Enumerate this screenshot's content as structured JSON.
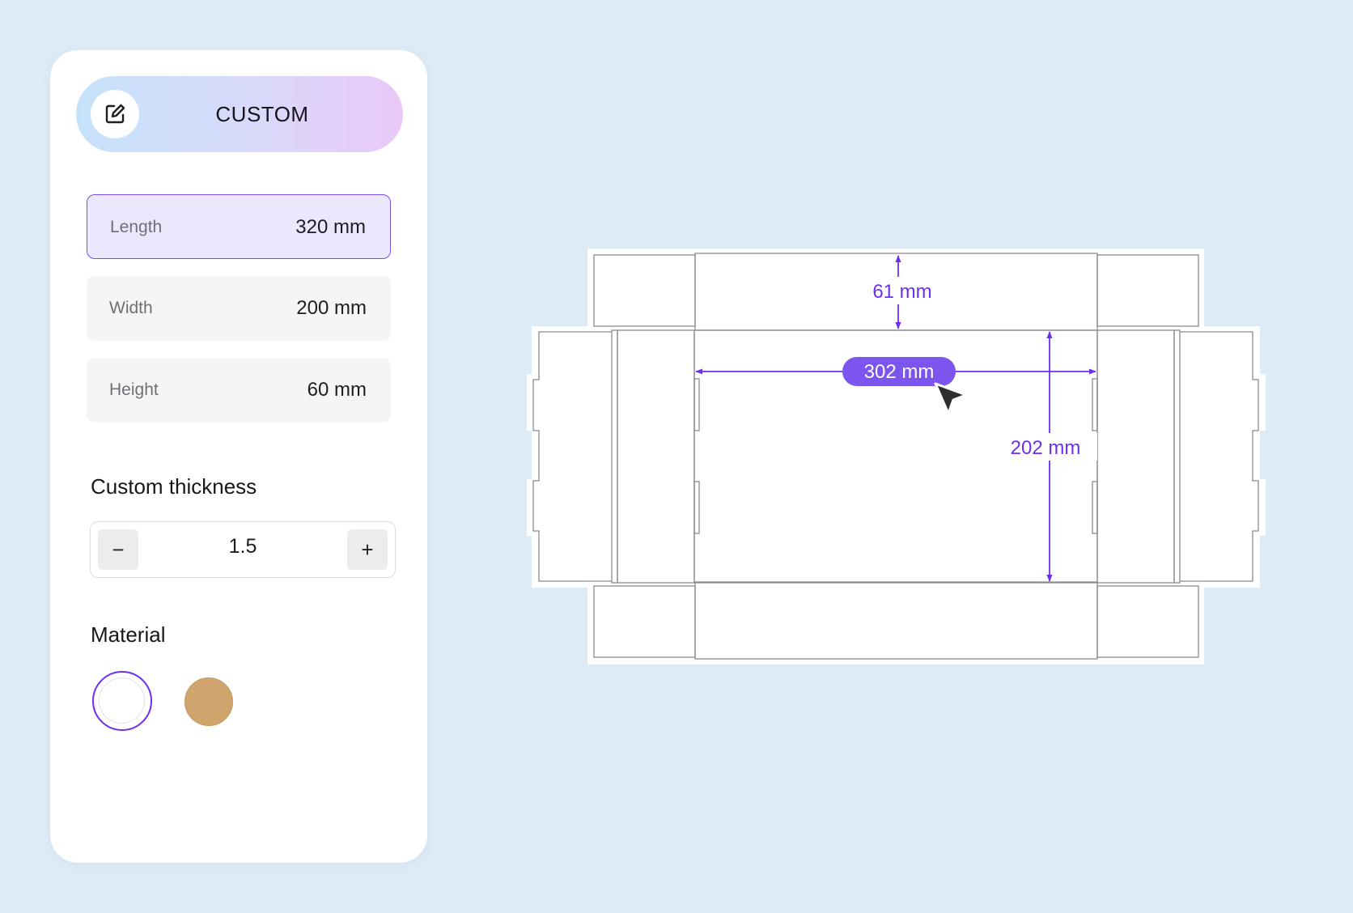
{
  "panel": {
    "mode": {
      "label": "CUSTOM",
      "icon": "edit-icon"
    },
    "dimensions": [
      {
        "label": "Length",
        "value": "320 mm",
        "active": true
      },
      {
        "label": "Width",
        "value": "200 mm",
        "active": false
      },
      {
        "label": "Height",
        "value": "60 mm",
        "active": false
      }
    ],
    "thickness": {
      "title": "Custom thickness",
      "value": "1.5",
      "decrement_label": "−",
      "increment_label": "+"
    },
    "material": {
      "title": "Material",
      "options": [
        {
          "name": "white",
          "color": "#ffffff",
          "selected": true
        },
        {
          "name": "kraft",
          "color": "#d0a46d",
          "selected": false
        }
      ]
    }
  },
  "diagram": {
    "height_dimension": "61 mm",
    "length_dimension": "302 mm",
    "width_dimension": "202 mm",
    "accent_color": "#6d2ff0",
    "badge_color": "#7c55ef",
    "cursor_icon": "pointer-cursor-icon"
  }
}
